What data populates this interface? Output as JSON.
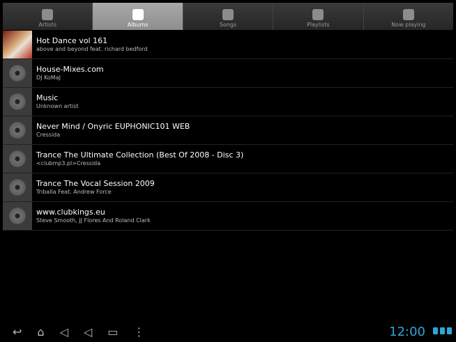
{
  "tabs": [
    {
      "label": "Artists",
      "icon": "microphone-icon"
    },
    {
      "label": "Albums",
      "icon": "album-disc-icon"
    },
    {
      "label": "Songs",
      "icon": "music-note-icon"
    },
    {
      "label": "Playlists",
      "icon": "playlist-icon"
    },
    {
      "label": "Now playing",
      "icon": "now-playing-icon"
    }
  ],
  "albums": [
    {
      "title": "Hot Dance vol 161",
      "artist": "above and beyond feat. richard bedford"
    },
    {
      "title": "House-Mixes.com",
      "artist": "DJ KoMaJ"
    },
    {
      "title": "Music",
      "artist": "Unknown artist"
    },
    {
      "title": "Never Mind / Onyric EUPHONIC101 WEB",
      "artist": "Cressida"
    },
    {
      "title": "Trance The Ultimate Collection (Best Of 2008 - Disc 3)",
      "artist": "<clubmp3.pl>Cressida"
    },
    {
      "title": "Trance The Vocal Session 2009",
      "artist": "Triballa Feat. Andrew Force"
    },
    {
      "title": "www.clubkings.eu",
      "artist": "Steve Smooth, JJ Flores And Roland Clark"
    }
  ],
  "status": {
    "time": "12:00"
  },
  "colors": {
    "accent": "#2ea5d8",
    "active_tab": "#9a9a9a"
  }
}
